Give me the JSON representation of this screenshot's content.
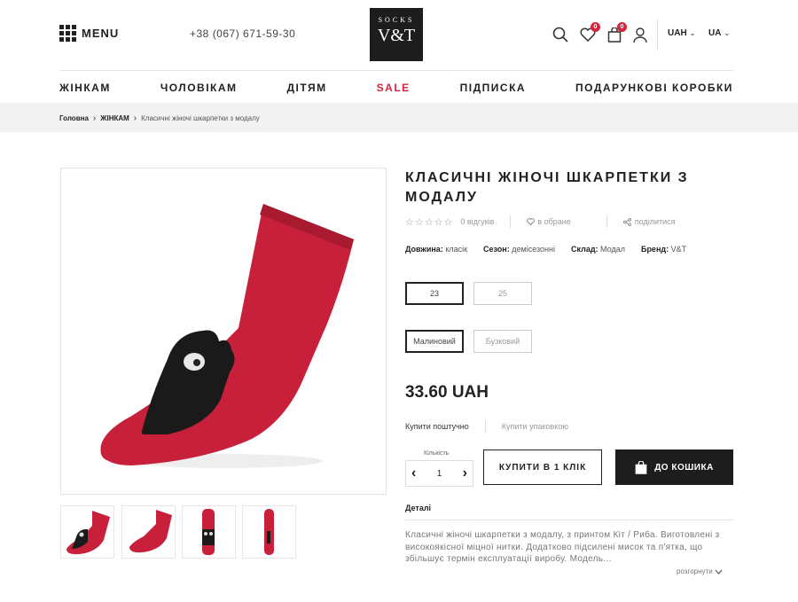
{
  "header": {
    "menu_label": "MENU",
    "phone": "+38 (067) 671-59-30",
    "logo_top": "SOCKS",
    "logo_main": "V&T",
    "wishlist_count": "0",
    "cart_count": "0",
    "currency": "UAH",
    "language": "UA"
  },
  "nav": [
    "ЖІНКАМ",
    "ЧОЛОВІКАМ",
    "ДІТЯМ",
    "SALE",
    "ПІДПИСКА",
    "ПОДАРУНКОВІ КОРОБКИ"
  ],
  "breadcrumb": {
    "home": "Головна",
    "category": "ЖІНКАМ",
    "current": "Класичні жіночі шкарпетки з модалу"
  },
  "product": {
    "title": "КЛАСИЧНІ ЖІНОЧІ ШКАРПЕТКИ З МОДАЛУ",
    "stars": "☆☆☆☆☆",
    "reviews": "0 відгуків",
    "favorite": "в обране",
    "share": "поділитися",
    "props": [
      {
        "label": "Довжина:",
        "value": "класік"
      },
      {
        "label": "Сезон:",
        "value": "демісезонні"
      },
      {
        "label": "Склад:",
        "value": "Модал"
      },
      {
        "label": "Бренд:",
        "value": "V&T"
      }
    ],
    "sizes": [
      "23",
      "25"
    ],
    "colors": [
      "Малиновий",
      "Бузковий"
    ],
    "price": "33.60 UAH",
    "buy_by_piece": "Купити поштучно",
    "buy_by_pack": "Купити упаковкою",
    "qty_label": "Кількість",
    "qty": "1",
    "buy_one_click": "КУПИТИ В 1 КЛІК",
    "add_to_cart": "ДО КОШИКА",
    "details_heading": "Деталі",
    "description": "Класичні жіночі шкарпетки з модалу, з принтом Кіт / Риба. Виготовлені з високоякісної міцної нитки. Додатково підсилені мисок та п'ятка, що збільшує термін експлуатації виробу. Модель...",
    "expand": "розгорнути"
  },
  "colors": {
    "accent": "#d8233f",
    "sock_red": "#c8203a",
    "dark": "#1d1d1d"
  }
}
